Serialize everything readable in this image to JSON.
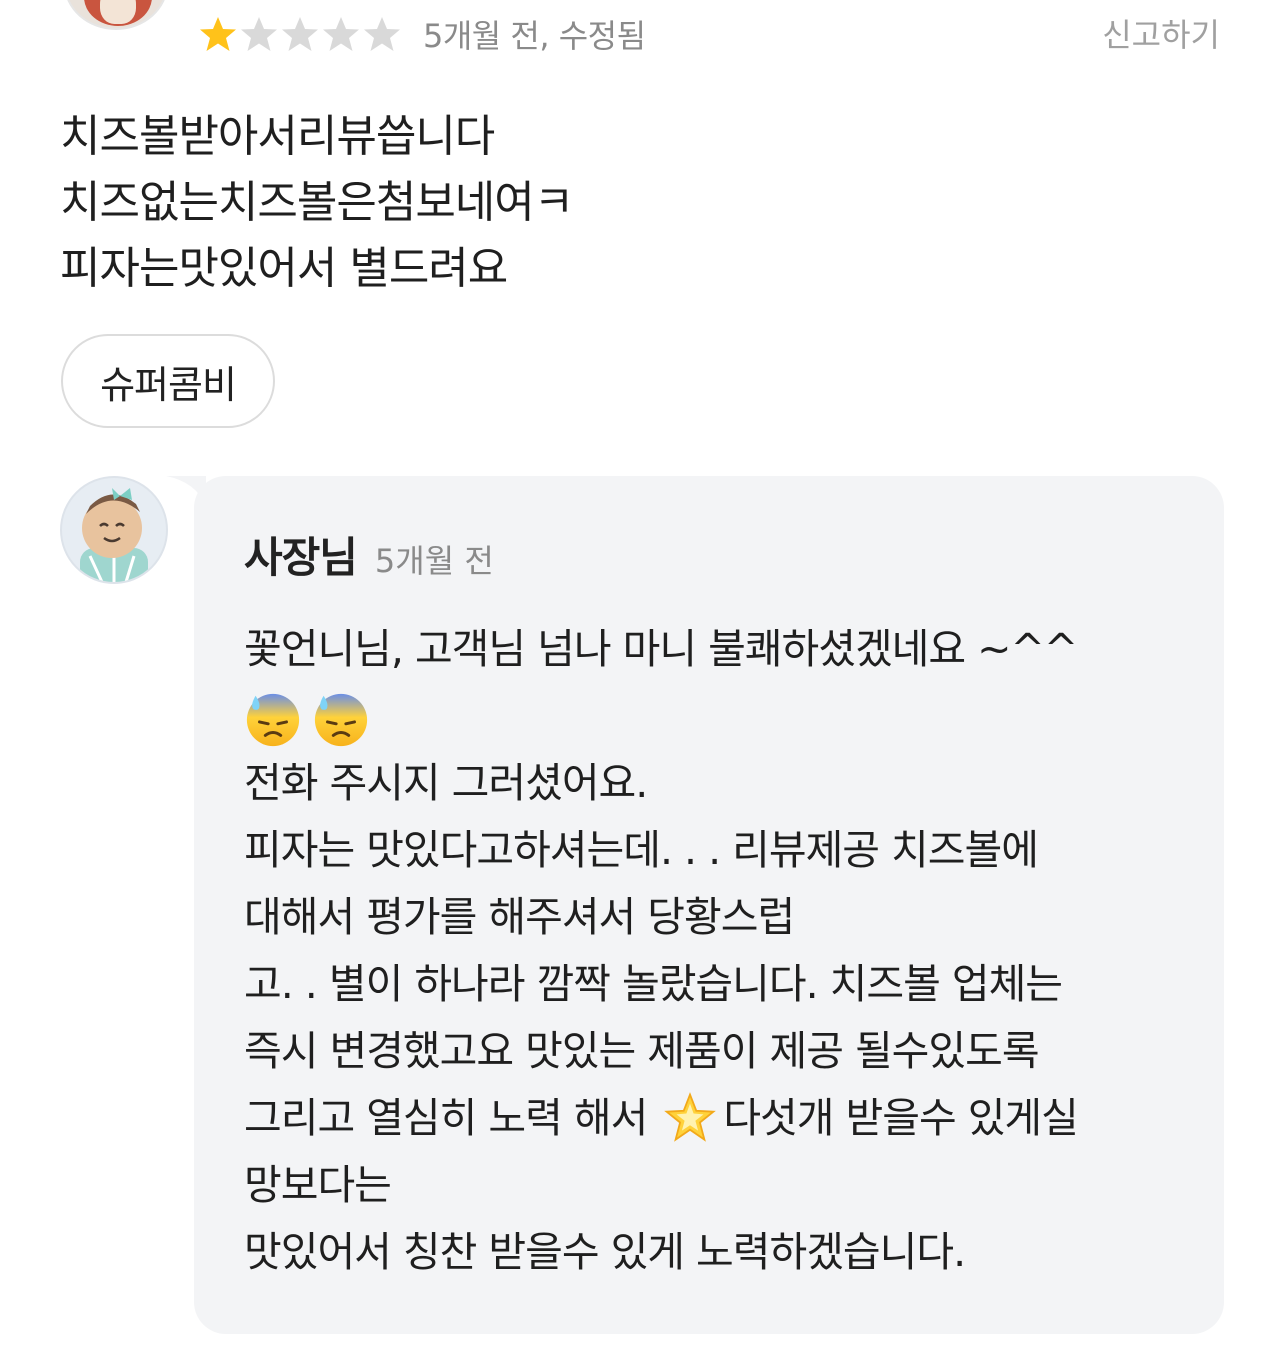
{
  "review": {
    "rating": 1,
    "max_rating": 5,
    "meta": "5개월 전, 수정됨",
    "report_label": "신고하기",
    "body_lines": [
      "치즈볼받아서리뷰씁니다",
      "치즈없는치즈볼은첨보네여ㅋ",
      "피자는맛있어서 별드려요"
    ],
    "menu_tag": "슈퍼콤비"
  },
  "reply": {
    "author": "사장님",
    "time": "5개월 전",
    "lines": [
      "꽃언니님, 고객님 넘나 마니 불쾌하셨겠네요 ~^^",
      "",
      "전화 주시지 그러셨어요.",
      "피자는 맛있다고하셔는데. . .  리뷰제공 치즈볼에",
      "대해서 평가를 해주셔서 당황스럽",
      "고. . 별이 하나라 깜짝 놀랐습니다. 치즈볼 업체는",
      "즉시 변경했고요 맛있는 제품이 제공 될수있도록"
    ],
    "line_before_star": "그리고 열심히 노력 해서",
    "line_after_star": "다섯개 받을수 있게실",
    "lines_tail": [
      "망보다는",
      "맛있어서 칭찬 받을수 있게 노력하겠습니다."
    ],
    "emoji_names": [
      "downcast-sweat-face-icon",
      "downcast-sweat-face-icon"
    ],
    "star_emoji_name": "glowing-star-icon"
  },
  "colors": {
    "star_filled": "#FFC21A",
    "star_empty": "#D9D9D9",
    "bubble_bg": "#F3F4F6",
    "muted_text": "#8A8A8A"
  }
}
